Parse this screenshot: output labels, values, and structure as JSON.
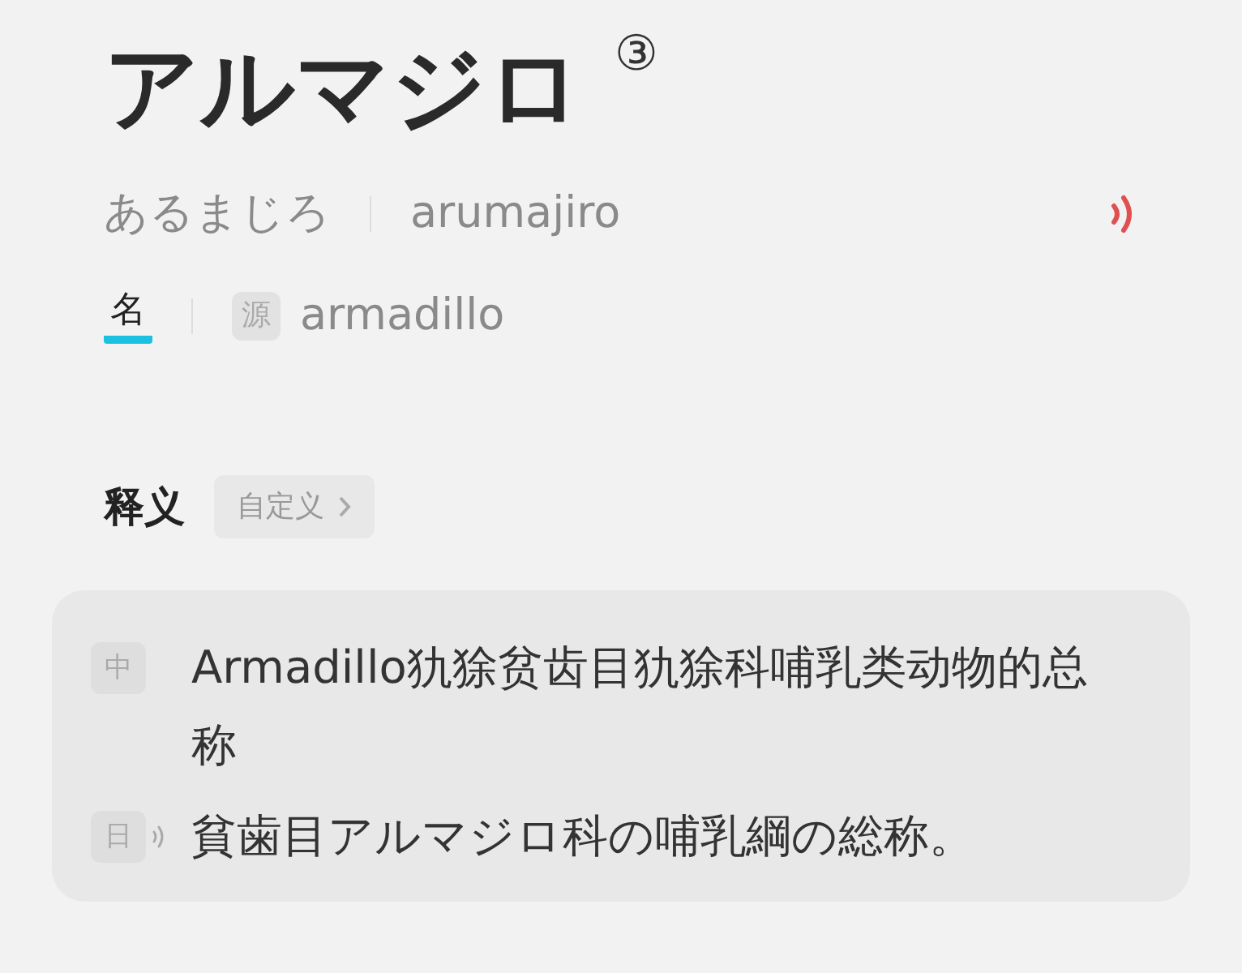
{
  "headword": {
    "text": "アルマジロ",
    "pitch": "③"
  },
  "reading": {
    "kana": "あるまじろ",
    "romaji": "arumajiro"
  },
  "pos_tabs": [
    {
      "label": "名",
      "selected": true
    }
  ],
  "origin": {
    "badge": "源",
    "word": "armadillo"
  },
  "definitions_section": {
    "title": "释义",
    "custom_button": "自定义"
  },
  "definitions": [
    {
      "lang_badge": "中",
      "text": "Armadillo犰狳贫齿目犰狳科哺乳类动物的总称",
      "has_audio": false
    },
    {
      "lang_badge": "日",
      "text": "貧歯目アルマジロ科の哺乳綱の総称。",
      "has_audio": true
    }
  ]
}
